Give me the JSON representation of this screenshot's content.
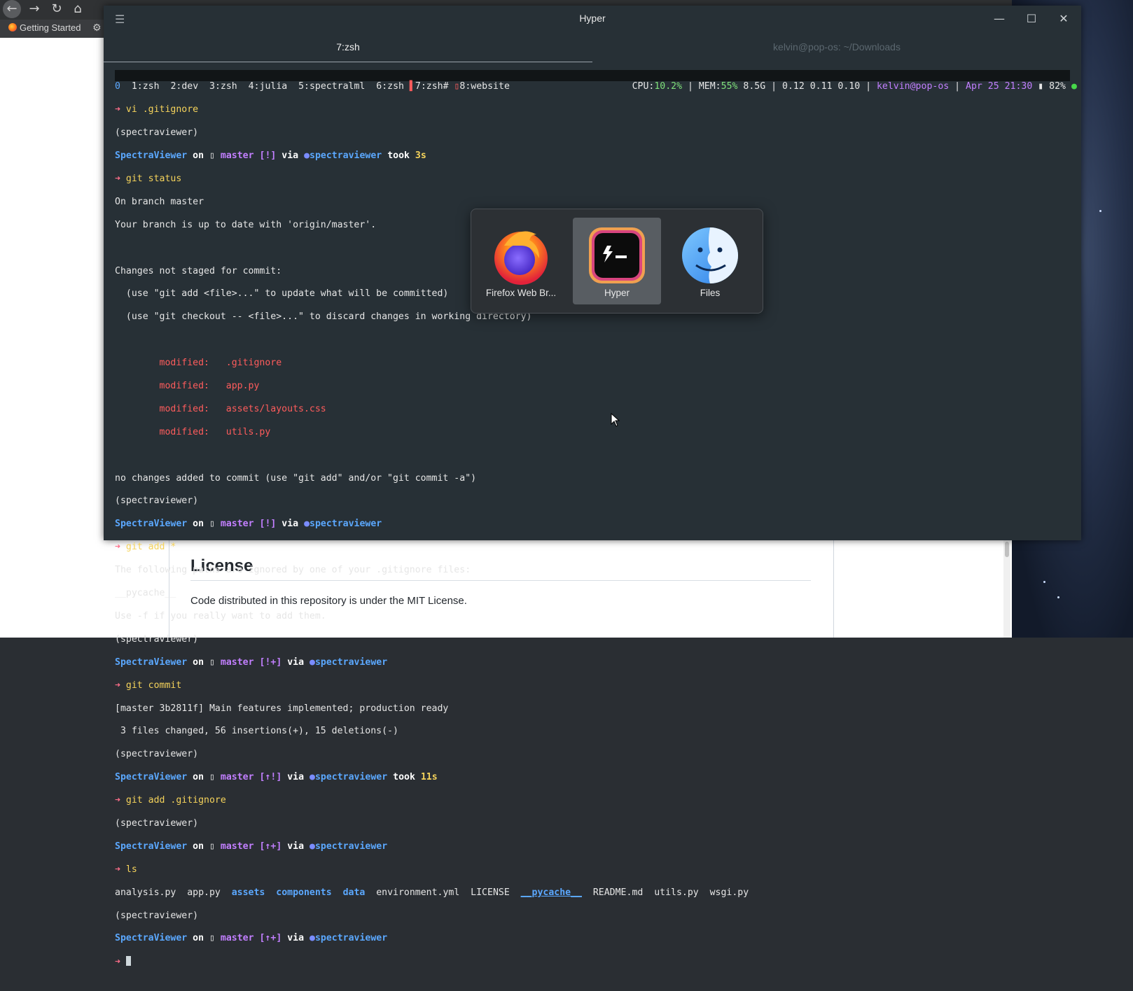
{
  "firefox": {
    "bookmark_label": "Getting Started",
    "readme_heading": "License",
    "readme_text": "Code distributed in this repository is under the MIT License."
  },
  "hyper": {
    "title": "Hyper",
    "tabs": [
      {
        "label": "7:zsh",
        "active": true
      },
      {
        "label": "kelvin@pop-os: ~/Downloads",
        "active": false
      }
    ],
    "status_bar": {
      "windows": [
        "0",
        "1:zsh",
        "2:dev",
        "3:zsh",
        "4:julia",
        "5:spectralml",
        "6:zsh",
        "7:zsh#",
        "8:website"
      ],
      "cpu_label": "CPU:",
      "cpu_value": "10.2%",
      "mem_label": "MEM:",
      "mem_value": "55%",
      "mem_size": "8.5G",
      "load": "0.12 0.11 0.10",
      "user": "kelvin@pop-os",
      "datetime": "Apr 25 21:30",
      "battery": "82%"
    },
    "terminal_lines": [
      "➜ vi .gitignore",
      "(spectraviewer)",
      "SpectraViewer on  master [!] via spectraviewer took 3s",
      "➜ git status",
      "On branch master",
      "Your branch is up to date with 'origin/master'.",
      "",
      "Changes not staged for commit:",
      "  (use \"git add <file>...\" to update what will be committed)",
      "  (use \"git checkout -- <file>...\" to discard changes in working directory)",
      "",
      "        modified:   .gitignore",
      "        modified:   app.py",
      "        modified:   assets/layouts.css",
      "        modified:   utils.py",
      "",
      "no changes added to commit (use \"git add\" and/or \"git commit -a\")",
      "(spectraviewer)",
      "SpectraViewer on  master [!] via spectraviewer",
      "➜ git add *",
      "The following paths are ignored by one of your .gitignore files:",
      "__pycache__",
      "Use -f if you really want to add them.",
      "(spectraviewer)",
      "SpectraViewer on  master [!+] via spectraviewer",
      "➜ git commit",
      "[master 3b2811f] Main features implemented; production ready",
      " 3 files changed, 56 insertions(+), 15 deletions(-)",
      "(spectraviewer)",
      "SpectraViewer on  master [↑!] via spectraviewer took 11s",
      "➜ git add .gitignore",
      "(spectraviewer)",
      "SpectraViewer on  master [↑+] via spectraviewer",
      "➜ ls",
      "analysis.py  app.py  assets  components  data  environment.yml  LICENSE  __pycache__  README.md  utils.py  wsgi.py",
      "(spectraviewer)",
      "SpectraViewer on  master [↑+] via spectraviewer",
      "➜ "
    ]
  },
  "switcher": {
    "apps": [
      {
        "label": "Firefox Web Br...",
        "icon": "firefox-icon",
        "selected": false
      },
      {
        "label": "Hyper",
        "icon": "hyper-icon",
        "selected": true
      },
      {
        "label": "Files",
        "icon": "files-icon",
        "selected": false
      }
    ]
  },
  "colors": {
    "terminal_bg": "#273036",
    "prompt_arrow": "#ff6e8a",
    "command": "#f5d35b",
    "repo": "#5ba8ff",
    "branch": "#c27fff",
    "modified": "#ff5c5c"
  }
}
